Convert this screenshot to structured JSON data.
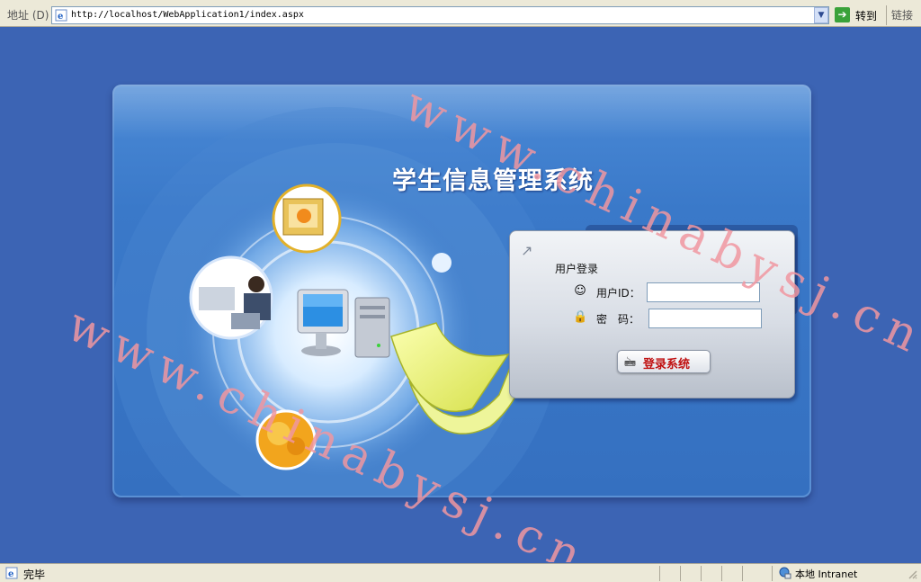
{
  "address_bar": {
    "label": "地址 (D)",
    "url": "http://localhost/WebApplication1/index.aspx",
    "go_label": "转到",
    "links_label": "链接"
  },
  "page": {
    "title": "学生信息管理系统",
    "login": {
      "heading": "用户登录",
      "user_id_label": "用户ID：",
      "user_id_value": "",
      "password_label": "密　码：",
      "password_value": "",
      "submit_label": "登录系统"
    },
    "watermark": "www.chinabysj.cn"
  },
  "status_bar": {
    "status_text": "完毕",
    "zone_text": "本地 Intranet"
  },
  "colors": {
    "page_background": "#3c64b4",
    "panel_blue": "#3a79c9",
    "submit_text": "#c01010",
    "watermark": "#f096a0"
  }
}
